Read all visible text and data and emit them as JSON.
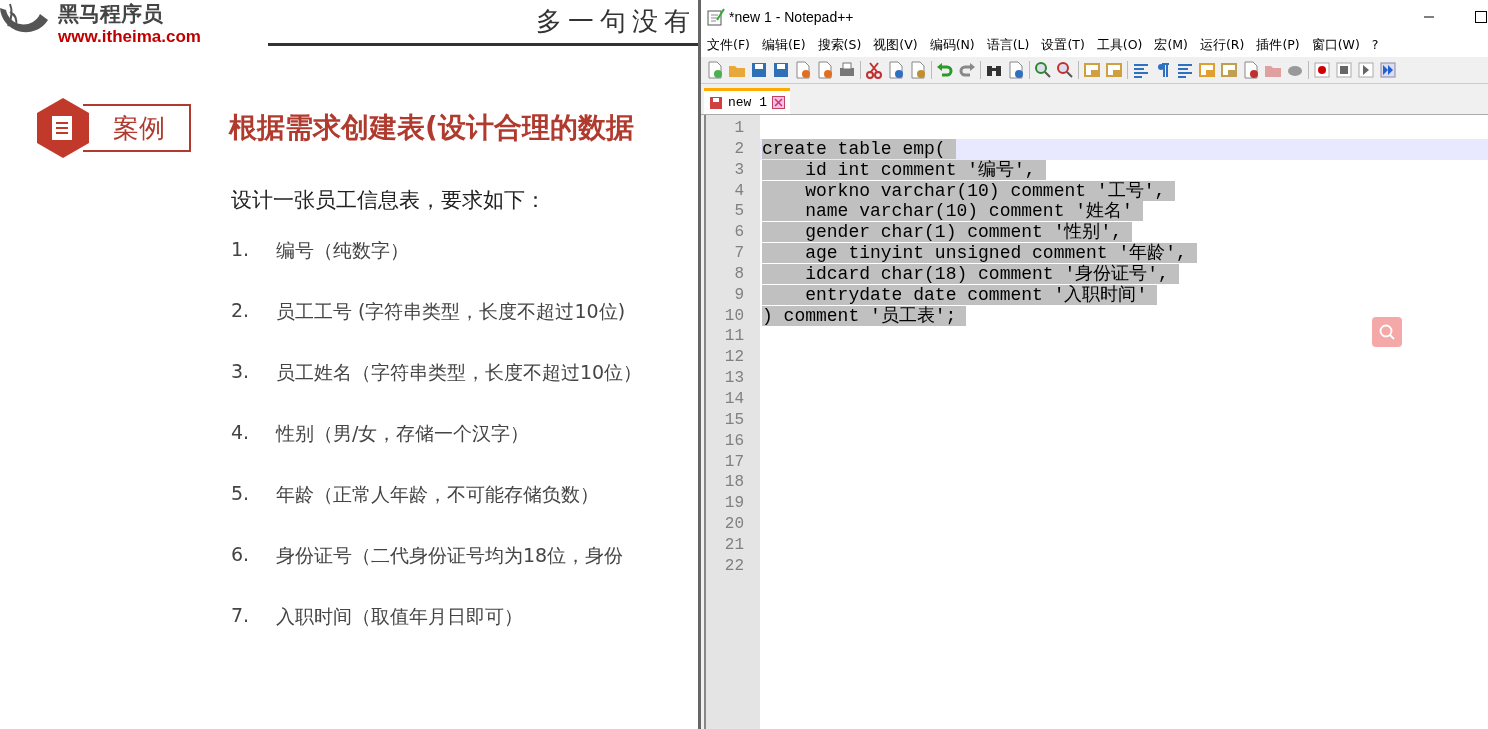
{
  "slide": {
    "logo": {
      "name": "黑马程序员",
      "url": "www.itheima.com"
    },
    "slogan": "多一句没有",
    "badge": "案例",
    "title": "根据需求创建表(设计合理的数据",
    "intro": "设计一张员工信息表，要求如下：",
    "items": [
      {
        "number": "1.",
        "text": "编号（纯数字）"
      },
      {
        "number": "2.",
        "text": "员工工号 (字符串类型，长度不超过10位)"
      },
      {
        "number": "3.",
        "text": "员工姓名（字符串类型，长度不超过10位）"
      },
      {
        "number": "4.",
        "text": "性别（男/女，存储一个汉字）"
      },
      {
        "number": "5.",
        "text": "年龄（正常人年龄，不可能存储负数）"
      },
      {
        "number": "6.",
        "text": "身份证号（二代身份证号均为18位，身份"
      },
      {
        "number": "7.",
        "text": "入职时间（取值年月日即可）"
      }
    ]
  },
  "window": {
    "title": "*new 1 - Notepad++",
    "menu": [
      "文件(F)",
      "编辑(E)",
      "搜索(S)",
      "视图(V)",
      "编码(N)",
      "语言(L)",
      "设置(T)",
      "工具(O)",
      "宏(M)",
      "运行(R)",
      "插件(P)",
      "窗口(W)",
      "?"
    ],
    "tabs": [
      {
        "label": "new 1",
        "selected": true,
        "modified": true
      }
    ],
    "lines": [
      {
        "number": "1",
        "selected": false,
        "current": false
      },
      {
        "number": "2",
        "text": "create table emp(",
        "selected": true,
        "current": true
      },
      {
        "number": "3",
        "text": "    id int comment '编号',",
        "selected": true,
        "current": false
      },
      {
        "number": "4",
        "text": "    workno varchar(10) comment '工号',",
        "selected": true,
        "current": false
      },
      {
        "number": "5",
        "text": "    name varchar(10) comment '姓名'",
        "selected": true,
        "current": false
      },
      {
        "number": "6",
        "text": "    gender char(1) comment '性别',",
        "selected": true,
        "current": false
      },
      {
        "number": "7",
        "text": "    age tinyint unsigned comment '年龄',",
        "selected": true,
        "current": false
      },
      {
        "number": "8",
        "text": "    idcard char(18) comment '身份证号',",
        "selected": true,
        "current": false
      },
      {
        "number": "9",
        "text": "    entrydate date comment '入职时间'",
        "selected": true,
        "current": false
      },
      {
        "number": "10",
        "text": ") comment '员工表';",
        "selected": true,
        "current": false
      },
      {
        "number": "11",
        "selected": false,
        "current": false
      },
      {
        "number": "12",
        "selected": false,
        "current": false
      },
      {
        "number": "13",
        "selected": false,
        "current": false
      },
      {
        "number": "14",
        "selected": false,
        "current": false
      },
      {
        "number": "15",
        "selected": false,
        "current": false
      },
      {
        "number": "16",
        "selected": false,
        "current": false
      },
      {
        "number": "17",
        "selected": false,
        "current": false
      },
      {
        "number": "18",
        "selected": false,
        "current": false
      },
      {
        "number": "19",
        "selected": false,
        "current": false
      },
      {
        "number": "20",
        "selected": false,
        "current": false
      },
      {
        "number": "21",
        "selected": false,
        "current": false
      },
      {
        "number": "22",
        "selected": false,
        "current": false
      }
    ]
  }
}
